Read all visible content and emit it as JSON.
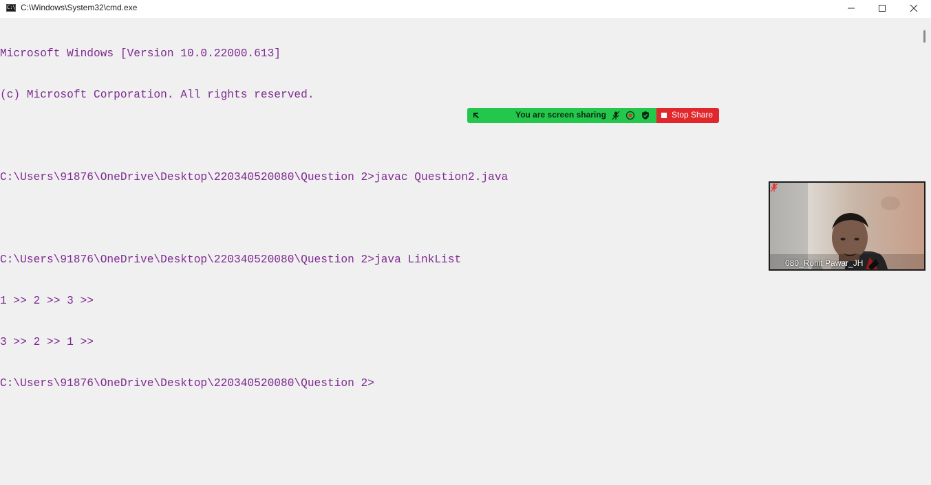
{
  "window": {
    "title": "C:\\Windows\\System32\\cmd.exe",
    "icon": "cmd-icon",
    "controls": [
      "minimize-icon",
      "maximize-icon",
      "close-icon"
    ]
  },
  "terminal": {
    "text_color": "#7e2a90",
    "background": "#f0f0f0",
    "lines": [
      "Microsoft Windows [Version 10.0.22000.613]",
      "(c) Microsoft Corporation. All rights reserved.",
      "",
      "C:\\Users\\91876\\OneDrive\\Desktop\\220340520080\\Question 2>javac Question2.java",
      "",
      "C:\\Users\\91876\\OneDrive\\Desktop\\220340520080\\Question 2>java LinkList",
      "1 >> 2 >> 3 >>",
      "3 >> 2 >> 1 >>",
      "C:\\Users\\91876\\OneDrive\\Desktop\\220340520080\\Question 2>"
    ]
  },
  "share_bar": {
    "status_text": "You are screen sharing",
    "stop_label": "Stop Share",
    "green_color": "#23c74b",
    "stop_color": "#e0272b",
    "icons": [
      "drag-handle-icon",
      "mic-muted-icon",
      "record-icon",
      "shield-icon",
      "stop-square-icon"
    ]
  },
  "video": {
    "participant_name": "080_Rohit Pawar_JH",
    "mic_icon": "mic-muted-icon"
  }
}
